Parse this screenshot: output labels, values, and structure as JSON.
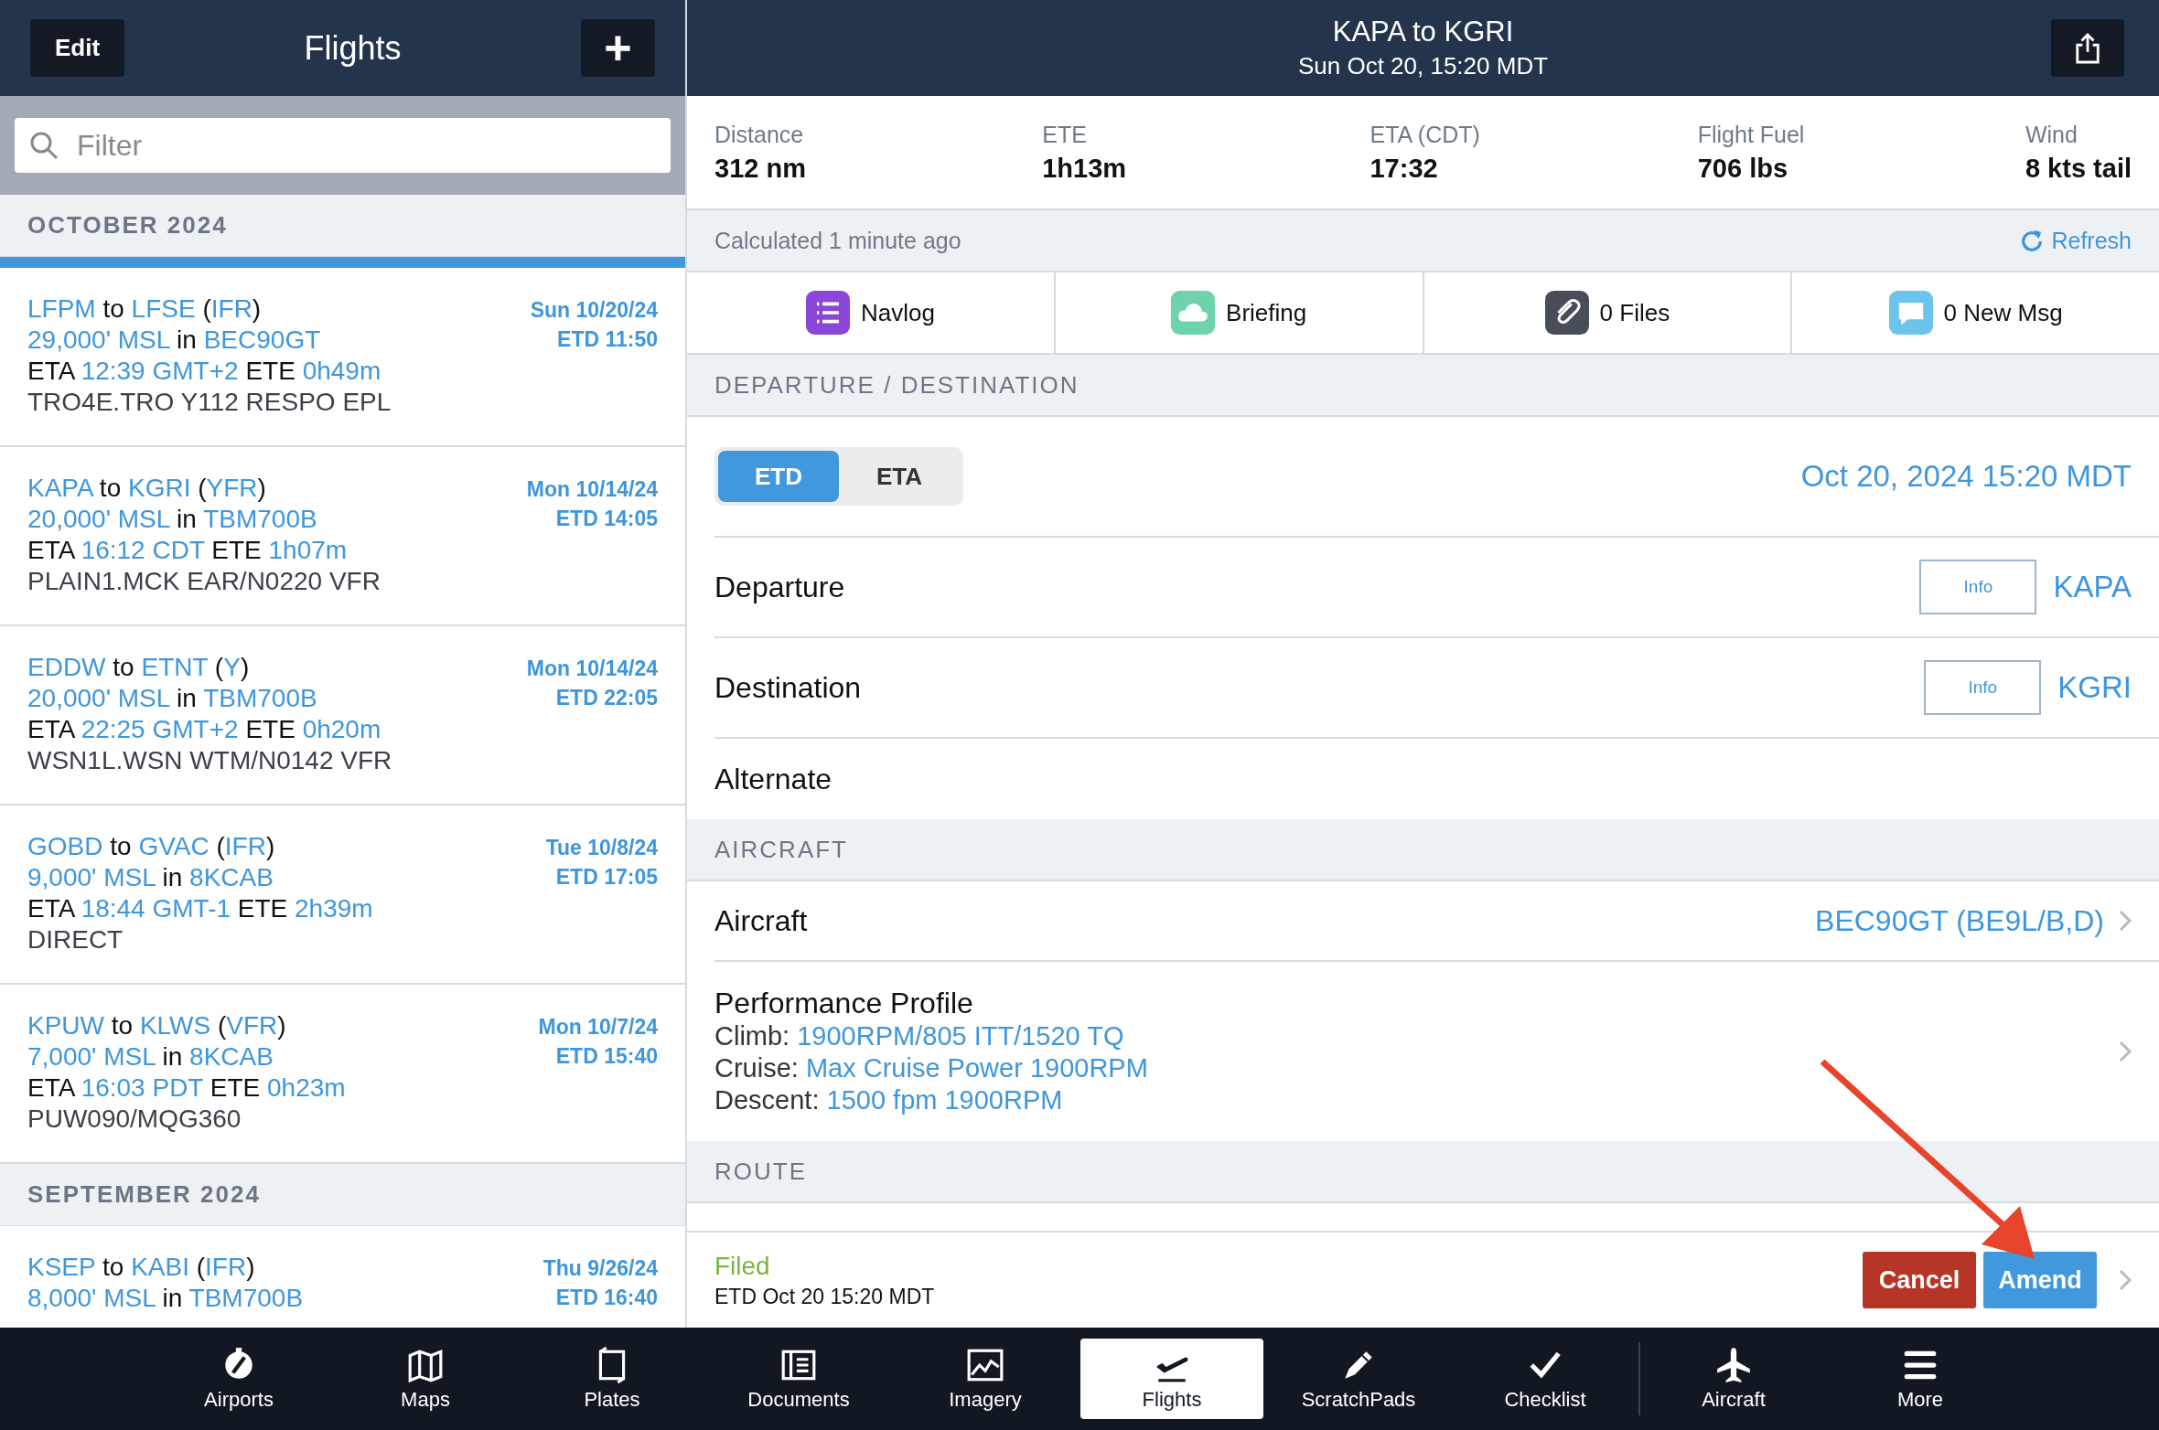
{
  "sidebar": {
    "edit_button": "Edit",
    "title": "Flights",
    "add_button": "+",
    "filter": {
      "placeholder": "Filter"
    },
    "sections": [
      {
        "heading": "OCTOBER 2024",
        "flights": [
          {
            "selected": true,
            "lines": [
              [
                {
                  "text": "LFPM",
                  "accent": true
                },
                {
                  "text": " to ",
                  "accent": false
                },
                {
                  "text": "LFSE",
                  "accent": true
                },
                {
                  "text": " (",
                  "accent": false
                },
                {
                  "text": "IFR",
                  "accent": true
                },
                {
                  "text": ")",
                  "accent": false
                }
              ],
              [
                {
                  "text": "29,000' MSL",
                  "accent": true
                },
                {
                  "text": " in ",
                  "accent": false
                },
                {
                  "text": "BEC90GT",
                  "accent": true
                }
              ],
              [
                {
                  "text": "ETA ",
                  "accent": false
                },
                {
                  "text": "12:39 GMT+2",
                  "accent": true
                },
                {
                  "text": " ETE ",
                  "accent": false
                },
                {
                  "text": "0h49m",
                  "accent": true
                }
              ]
            ],
            "route": "TRO4E.TRO Y112 RESPO EPL",
            "date": "Sun 10/20/24",
            "etd": "ETD 11:50"
          },
          {
            "selected": false,
            "lines": [
              [
                {
                  "text": "KAPA",
                  "accent": true
                },
                {
                  "text": " to ",
                  "accent": false
                },
                {
                  "text": "KGRI",
                  "accent": true
                },
                {
                  "text": " (",
                  "accent": false
                },
                {
                  "text": "YFR",
                  "accent": true
                },
                {
                  "text": ")",
                  "accent": false
                }
              ],
              [
                {
                  "text": "20,000' MSL",
                  "accent": true
                },
                {
                  "text": " in ",
                  "accent": false
                },
                {
                  "text": "TBM700B",
                  "accent": true
                }
              ],
              [
                {
                  "text": "ETA ",
                  "accent": false
                },
                {
                  "text": "16:12 CDT",
                  "accent": true
                },
                {
                  "text": " ETE ",
                  "accent": false
                },
                {
                  "text": "1h07m",
                  "accent": true
                }
              ]
            ],
            "route": "PLAIN1.MCK EAR/N0220 VFR",
            "date": "Mon 10/14/24",
            "etd": "ETD 14:05"
          },
          {
            "selected": false,
            "lines": [
              [
                {
                  "text": "EDDW",
                  "accent": true
                },
                {
                  "text": " to ",
                  "accent": false
                },
                {
                  "text": "ETNT",
                  "accent": true
                },
                {
                  "text": " (",
                  "accent": false
                },
                {
                  "text": "Y",
                  "accent": true
                },
                {
                  "text": ")",
                  "accent": false
                }
              ],
              [
                {
                  "text": "20,000' MSL",
                  "accent": true
                },
                {
                  "text": " in ",
                  "accent": false
                },
                {
                  "text": "TBM700B",
                  "accent": true
                }
              ],
              [
                {
                  "text": "ETA ",
                  "accent": false
                },
                {
                  "text": "22:25 GMT+2",
                  "accent": true
                },
                {
                  "text": " ETE ",
                  "accent": false
                },
                {
                  "text": "0h20m",
                  "accent": true
                }
              ]
            ],
            "route": "WSN1L.WSN WTM/N0142 VFR",
            "date": "Mon 10/14/24",
            "etd": "ETD 22:05"
          },
          {
            "selected": false,
            "lines": [
              [
                {
                  "text": "GOBD",
                  "accent": true
                },
                {
                  "text": " to ",
                  "accent": false
                },
                {
                  "text": "GVAC",
                  "accent": true
                },
                {
                  "text": " (",
                  "accent": false
                },
                {
                  "text": "IFR",
                  "accent": true
                },
                {
                  "text": ")",
                  "accent": false
                }
              ],
              [
                {
                  "text": "9,000' MSL",
                  "accent": true
                },
                {
                  "text": " in ",
                  "accent": false
                },
                {
                  "text": "8KCAB",
                  "accent": true
                }
              ],
              [
                {
                  "text": "ETA ",
                  "accent": false
                },
                {
                  "text": "18:44 GMT-1",
                  "accent": true
                },
                {
                  "text": " ETE ",
                  "accent": false
                },
                {
                  "text": "2h39m",
                  "accent": true
                }
              ]
            ],
            "route": "DIRECT",
            "date": "Tue 10/8/24",
            "etd": "ETD 17:05"
          },
          {
            "selected": false,
            "lines": [
              [
                {
                  "text": "KPUW",
                  "accent": true
                },
                {
                  "text": " to ",
                  "accent": false
                },
                {
                  "text": "KLWS",
                  "accent": true
                },
                {
                  "text": " (",
                  "accent": false
                },
                {
                  "text": "VFR",
                  "accent": true
                },
                {
                  "text": ")",
                  "accent": false
                }
              ],
              [
                {
                  "text": "7,000' MSL",
                  "accent": true
                },
                {
                  "text": " in ",
                  "accent": false
                },
                {
                  "text": "8KCAB",
                  "accent": true
                }
              ],
              [
                {
                  "text": "ETA ",
                  "accent": false
                },
                {
                  "text": "16:03 PDT",
                  "accent": true
                },
                {
                  "text": " ETE ",
                  "accent": false
                },
                {
                  "text": "0h23m",
                  "accent": true
                }
              ]
            ],
            "route": "PUW090/MQG360",
            "date": "Mon 10/7/24",
            "etd": "ETD 15:40"
          }
        ]
      },
      {
        "heading": "SEPTEMBER 2024",
        "flights": [
          {
            "selected": false,
            "lines": [
              [
                {
                  "text": "KSEP",
                  "accent": true
                },
                {
                  "text": " to ",
                  "accent": false
                },
                {
                  "text": "KABI",
                  "accent": true
                },
                {
                  "text": " (",
                  "accent": false
                },
                {
                  "text": "IFR",
                  "accent": true
                },
                {
                  "text": ")",
                  "accent": false
                }
              ],
              [
                {
                  "text": "8,000' MSL",
                  "accent": true
                },
                {
                  "text": " in ",
                  "accent": false
                },
                {
                  "text": "TBM700B",
                  "accent": true
                }
              ]
            ],
            "date": "Thu 9/26/24",
            "etd": "ETD 16:40"
          }
        ]
      }
    ]
  },
  "detail": {
    "title": "KAPA to KGRI",
    "subtitle": "Sun Oct 20, 15:20 MDT",
    "stats": [
      {
        "label": "Distance",
        "value": "312 nm"
      },
      {
        "label": "ETE",
        "value": "1h13m"
      },
      {
        "label": "ETA (CDT)",
        "value": "17:32"
      },
      {
        "label": "Flight Fuel",
        "value": "706 lbs"
      },
      {
        "label": "Wind",
        "value": "8 kts tail"
      }
    ],
    "calculated": "Calculated 1 minute ago",
    "refresh": "Refresh",
    "actions": [
      {
        "label": "Navlog",
        "color": "#8a46d8"
      },
      {
        "label": "Briefing",
        "color": "#6ed3a8"
      },
      {
        "label": "0 Files",
        "color": "#474e59"
      },
      {
        "label": "0 New Msg",
        "color": "#6cc4ea"
      }
    ],
    "dep_heading": "DEPARTURE / DESTINATION",
    "time_modes": [
      {
        "label": "ETD",
        "selected": true
      },
      {
        "label": "ETA",
        "selected": false
      }
    ],
    "time_value": "Oct 20, 2024 15:20 MDT",
    "airports": [
      {
        "label": "Departure",
        "info": "Info",
        "code": "KAPA"
      },
      {
        "label": "Destination",
        "info": "Info",
        "code": "KGRI"
      },
      {
        "label": "Alternate"
      }
    ],
    "aircraft_heading": "AIRCRAFT",
    "aircraft_label": "Aircraft",
    "aircraft_value": "BEC90GT (BE9L/B,D)",
    "profile": {
      "title": "Performance Profile",
      "lines": [
        {
          "label": "Climb: ",
          "value": "1900RPM/805 ITT/1520 TQ"
        },
        {
          "label": "Cruise: ",
          "value": "Max Cruise Power 1900RPM"
        },
        {
          "label": "Descent: ",
          "value": "1500 fpm 1900RPM"
        }
      ]
    },
    "route_heading": "ROUTE",
    "filing": {
      "status": "Filed",
      "detail": "ETD Oct 20 15:20 MDT",
      "cancel": "Cancel",
      "amend": "Amend"
    }
  },
  "tab_bar": [
    {
      "label": "Airports",
      "selected": false
    },
    {
      "label": "Maps",
      "selected": false
    },
    {
      "label": "Plates",
      "selected": false
    },
    {
      "label": "Documents",
      "selected": false
    },
    {
      "label": "Imagery",
      "selected": false
    },
    {
      "label": "Flights",
      "selected": true
    },
    {
      "label": "ScratchPads",
      "selected": false
    },
    {
      "label": "Checklist",
      "selected": false
    },
    {
      "label": "Aircraft",
      "selected": false
    },
    {
      "label": "More",
      "selected": false
    }
  ]
}
